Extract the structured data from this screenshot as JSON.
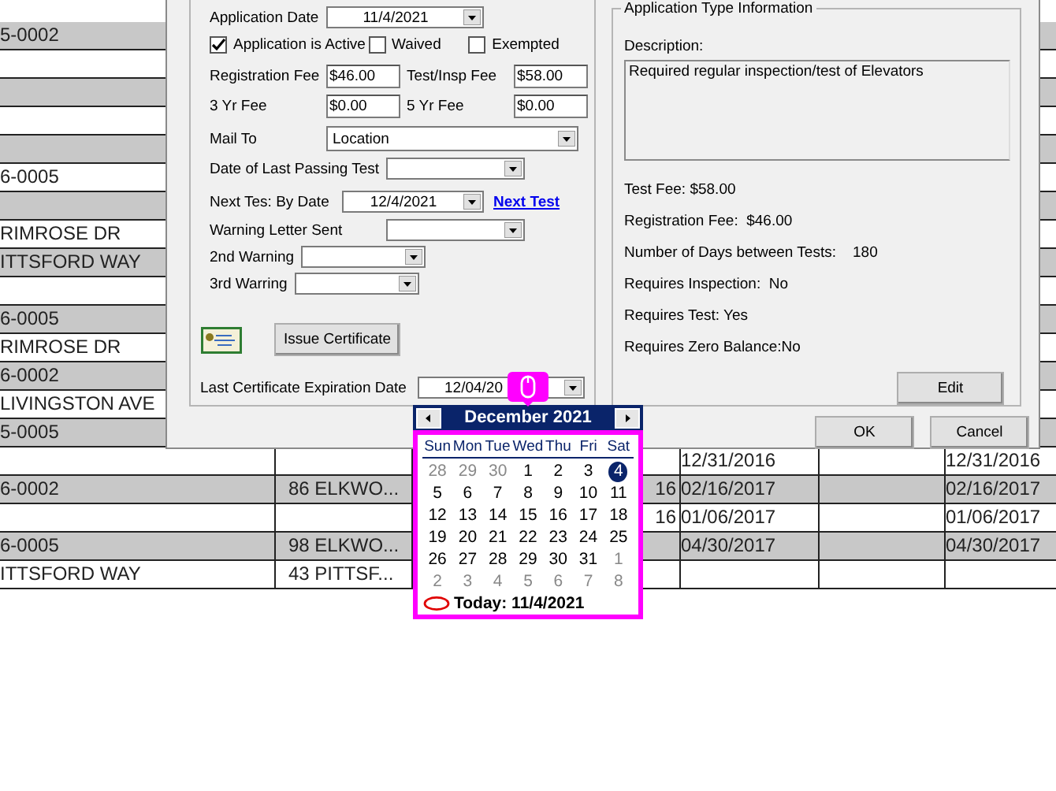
{
  "table": {
    "rows": [
      {
        "column_1": "5-0002"
      },
      {},
      {},
      {},
      {},
      {
        "column_1": "6-0005"
      },
      {},
      {
        "column_1": "RIMROSE DR"
      },
      {
        "column_1": "ITTSFORD WAY"
      },
      {},
      {
        "column_1": "6-0005"
      },
      {
        "column_1": "RIMROSE DR"
      },
      {
        "column_1": "6-0002"
      },
      {
        "column_1": "LIVINGSTON AVE"
      },
      {
        "column_1": "5-0005"
      },
      {
        "column_4": "12/31/2016",
        "column_6": "12/31/2016"
      },
      {
        "column_1": "6-0002",
        "column_2": "86 ELKWO...",
        "column_3": "16",
        "column_4": "02/16/2017",
        "column_6": "02/16/2017"
      },
      {
        "column_3": "16",
        "column_4": "01/06/2017",
        "column_6": "01/06/2017"
      },
      {
        "column_1": "6-0005",
        "column_2": "98 ELKWO...",
        "column_4": "04/30/2017",
        "column_6": "04/30/2017"
      },
      {
        "column_1": "ITTSFORD WAY",
        "column_2": "43 PITTSF..."
      }
    ]
  },
  "dialog": {
    "application_date": {
      "label": "Application Date",
      "value": "11/4/2021"
    },
    "checkboxes": [
      {
        "label": "Application is Active",
        "checked": true
      },
      {
        "label": "Waived",
        "checked": false
      },
      {
        "label": "Exempted",
        "checked": false
      }
    ],
    "fees": [
      {
        "label": "Registration Fee",
        "value": "$46.00"
      },
      {
        "label": "Test/Insp  Fee",
        "value": "$58.00"
      },
      {
        "label": "3 Yr Fee",
        "value": "$0.00"
      },
      {
        "label": "5 Yr Fee",
        "value": "$0.00"
      }
    ],
    "mail_to": {
      "label": "Mail To",
      "value": "Location"
    },
    "last_passing_test": {
      "label": "Date of Last Passing Test"
    },
    "next_test": {
      "label": "Next Tes: By Date",
      "value": "12/4/2021",
      "link": "Next Test"
    },
    "warning_letter": {
      "label": "Warning Letter Sent"
    },
    "warnings": [
      {
        "label": "2nd Warning"
      },
      {
        "label": "3rd Warring"
      }
    ],
    "certificate": {
      "button": "Issue Certificate",
      "expiration_label": "Last Certificate Expiration Date",
      "expiration_value": "12/04/20"
    },
    "type_info": {
      "title": "Application Type Information",
      "description_label": "Description:",
      "description": "Required regular inspection/test of Elevators",
      "facts": [
        "Test Fee: $58.00",
        "Registration Fee:  $46.00",
        "Number of Days between Tests:    180",
        "Requires Inspection:  No",
        "Requires Test: Yes",
        "Requires Zero Balance:No"
      ],
      "edit_button": "Edit"
    },
    "buttons": [
      "OK",
      "Cancel"
    ]
  },
  "calendar": {
    "month": "December 2021",
    "weekdays": [
      "Sun",
      "Mon",
      "Tue",
      "Wed",
      "Thu",
      "Fri",
      "Sat"
    ],
    "weeks": [
      [
        {
          "day": "28",
          "other_month": true,
          "selected": false
        },
        {
          "day": "29",
          "other_month": true,
          "selected": false
        },
        {
          "day": "30",
          "other_month": true,
          "selected": false
        },
        {
          "day": "1",
          "other_month": false,
          "selected": false
        },
        {
          "day": "2",
          "other_month": false,
          "selected": false
        },
        {
          "day": "3",
          "other_month": false,
          "selected": false
        },
        {
          "day": "4",
          "other_month": false,
          "selected": true
        }
      ],
      [
        {
          "day": "5",
          "other_month": false,
          "selected": false
        },
        {
          "day": "6",
          "other_month": false,
          "selected": false
        },
        {
          "day": "7",
          "other_month": false,
          "selected": false
        },
        {
          "day": "8",
          "other_month": false,
          "selected": false
        },
        {
          "day": "9",
          "other_month": false,
          "selected": false
        },
        {
          "day": "10",
          "other_month": false,
          "selected": false
        },
        {
          "day": "11",
          "other_month": false,
          "selected": false
        }
      ],
      [
        {
          "day": "12",
          "other_month": false,
          "selected": false
        },
        {
          "day": "13",
          "other_month": false,
          "selected": false
        },
        {
          "day": "14",
          "other_month": false,
          "selected": false
        },
        {
          "day": "15",
          "other_month": false,
          "selected": false
        },
        {
          "day": "16",
          "other_month": false,
          "selected": false
        },
        {
          "day": "17",
          "other_month": false,
          "selected": false
        },
        {
          "day": "18",
          "other_month": false,
          "selected": false
        }
      ],
      [
        {
          "day": "19",
          "other_month": false,
          "selected": false
        },
        {
          "day": "20",
          "other_month": false,
          "selected": false
        },
        {
          "day": "21",
          "other_month": false,
          "selected": false
        },
        {
          "day": "22",
          "other_month": false,
          "selected": false
        },
        {
          "day": "23",
          "other_month": false,
          "selected": false
        },
        {
          "day": "24",
          "other_month": false,
          "selected": false
        },
        {
          "day": "25",
          "other_month": false,
          "selected": false
        }
      ],
      [
        {
          "day": "26",
          "other_month": false,
          "selected": false
        },
        {
          "day": "27",
          "other_month": false,
          "selected": false
        },
        {
          "day": "28",
          "other_month": false,
          "selected": false
        },
        {
          "day": "29",
          "other_month": false,
          "selected": false
        },
        {
          "day": "30",
          "other_month": false,
          "selected": false
        },
        {
          "day": "31",
          "other_month": false,
          "selected": false
        },
        {
          "day": "1",
          "other_month": true,
          "selected": false
        }
      ],
      [
        {
          "day": "2",
          "other_month": true,
          "selected": false
        },
        {
          "day": "3",
          "other_month": true,
          "selected": false
        },
        {
          "day": "4",
          "other_month": true,
          "selected": false
        },
        {
          "day": "5",
          "other_month": true,
          "selected": false
        },
        {
          "day": "6",
          "other_month": true,
          "selected": false
        },
        {
          "day": "7",
          "other_month": true,
          "selected": false
        },
        {
          "day": "8",
          "other_month": true,
          "selected": false
        }
      ]
    ],
    "today_label": "Today: 11/4/2021"
  }
}
